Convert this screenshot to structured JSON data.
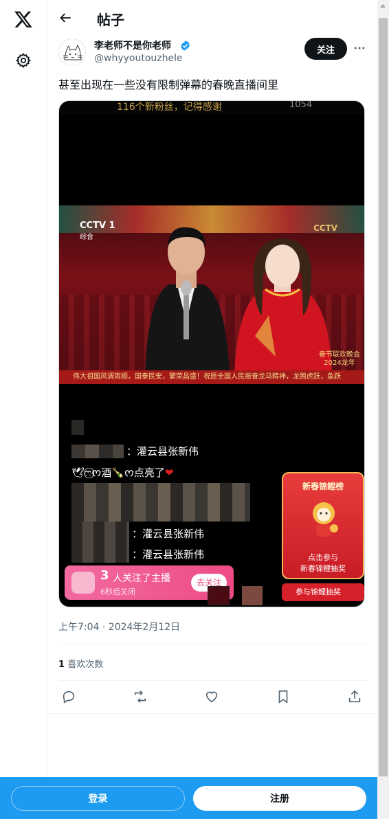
{
  "header": {
    "title": "帖子"
  },
  "author": {
    "name": "李老师不是你老师",
    "handle": "@whyyoutouzhele",
    "follow_label": "关注"
  },
  "post": {
    "text": "甚至出现在一些没有限制弹幕的春晚直播间里",
    "timestamp": "上午7:04 · 2024年2月12日",
    "likes_count": "1",
    "likes_label": "喜欢次数"
  },
  "media": {
    "top_banner": "116个新粉丝，记得感谢",
    "top_count": "1054",
    "channel": "CCTV 1",
    "channel_sub": "综合",
    "logo_text": "春节联欢晚会 2024龙年",
    "ticker": "伟大祖国风调雨顺，国泰民安，繁荣昌盛！祝愿全国人民振奋龙马精神，龙腾虎跃，鱼跃",
    "chat": [
      {
        "text": "：灌云县张新伟"
      },
      {
        "text": "🕊ෆ⃝ᰔ酒🍾ᰔ点亮了"
      },
      {
        "text": "：灌云县张新伟"
      },
      {
        "text": "：灌云县张新伟"
      }
    ],
    "carp": {
      "title": "新春锦鲤榜",
      "line1": "点击参与",
      "line2": "新春锦鲤抽奖",
      "button": "参与锦鲤抽奖"
    },
    "follow_banner": {
      "number": "3",
      "text": "人关注了主播",
      "sub": "6秒后关闭",
      "button": "去关注"
    }
  },
  "bottom": {
    "login": "登录",
    "signup": "注册"
  },
  "colors": {
    "accent": "#1d9bf0",
    "verified": "#1d9bf0",
    "text": "#0f1419",
    "muted": "#536471"
  }
}
